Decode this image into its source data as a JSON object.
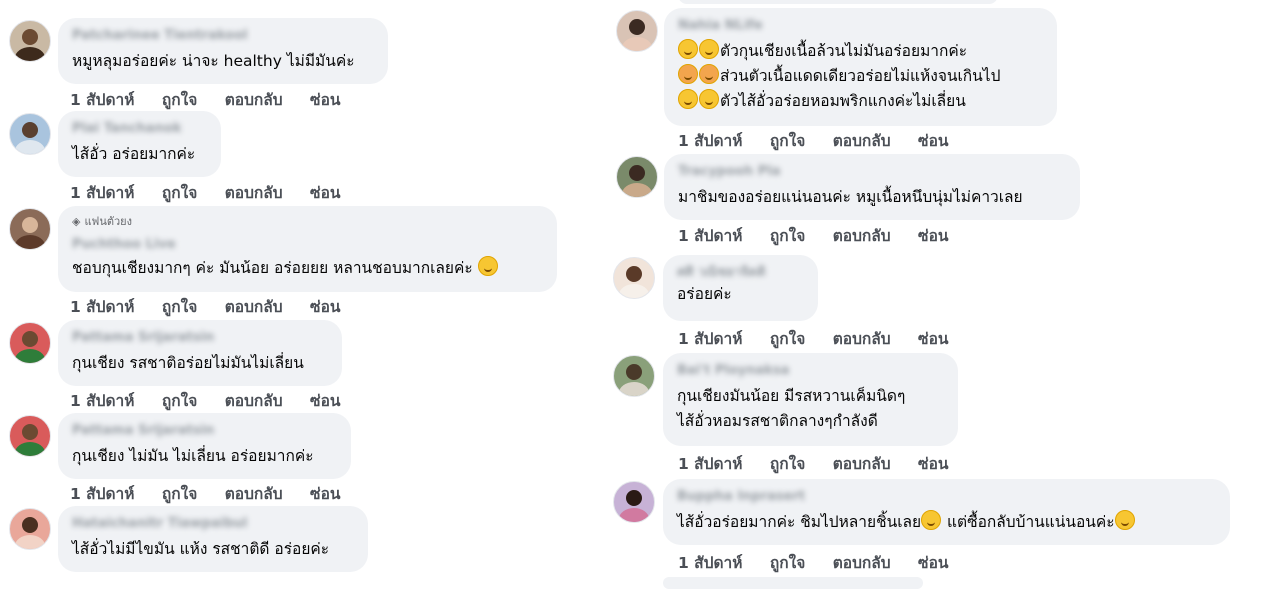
{
  "actions": {
    "time": "1 สัปดาห์",
    "like": "ถูกใจ",
    "reply": "ตอบกลับ",
    "hide": "ซ่อน"
  },
  "left_comments": [
    {
      "name": "Patcharinee Tientrakool",
      "lines": [
        "หมูหลุมอร่อยค่ะ น่าจะ healthy ไม่มีมันค่ะ"
      ]
    },
    {
      "name": "Plai Tanchanok",
      "lines": [
        "ไส้อั่ว อร่อยมากค่ะ"
      ]
    },
    {
      "badge": "แฟนตัวยง",
      "name": "Puchthoo Live",
      "lines": [
        "ชอบกุนเชียงมากๆ ค่ะ มันน้อย อร่อยยย หลานชอบมากเลยค่ะ"
      ]
    },
    {
      "name": "Pattama Srijaratsin",
      "lines": [
        "กุนเชียง รสชาติอร่อยไม่มันไม่เลี่ยน"
      ]
    },
    {
      "name": "Pattama Srijaratsin",
      "lines": [
        "กุนเชียง ไม่มัน ไม่เลี่ยน อร่อยมากค่ะ"
      ]
    },
    {
      "name": "Hataichanitr Tiawpaibul",
      "lines": [
        "ไส้อั่วไม่มีไขมัน แห้ง รสชาติดี อร่อยค่ะ"
      ]
    }
  ],
  "right_comments": [
    {
      "name": "Nahia NLife",
      "lines": [
        "ตัวกุนเชียงเนื้อล้วนไม่มันอร่อยมากค่ะ",
        "ส่วนตัวเนื้อแดดเดียวอร่อยไม่แห้งจนเกินไป",
        "ตัวไส้อั่วอร่อยหอมพริกแกงค่ะไม่เลี่ยน"
      ]
    },
    {
      "name": "Tracypooh Pla",
      "lines": [
        "มาชิมของอร่อยแน่นอนค่ะ หมูเนื้อหนึบนุ่มไม่คาวเลย"
      ]
    },
    {
      "name": "ศศิ วณิชยาจิตติ",
      "lines": [
        "อร่อยค่ะ"
      ]
    },
    {
      "name": "Bai't Ploynaksa",
      "lines": [
        "กุนเชียงมันน้อย มีรสหวานเค็มนิดๆ",
        "ไส้อั่วหอมรสชาติกลางๆกำลังดี"
      ]
    },
    {
      "name": "Buppha Inprasert",
      "lines": [
        "ไส้อั่วอร่อยมากค่ะ ชิมไปหลายชิ้นเลย",
        "แต่ซื้อกลับบ้านแน่นอนค่ะ"
      ]
    }
  ],
  "colors": {
    "bubble_bg": "#f0f2f5",
    "action_text": "#4b4f56",
    "comment_text": "#050505"
  }
}
